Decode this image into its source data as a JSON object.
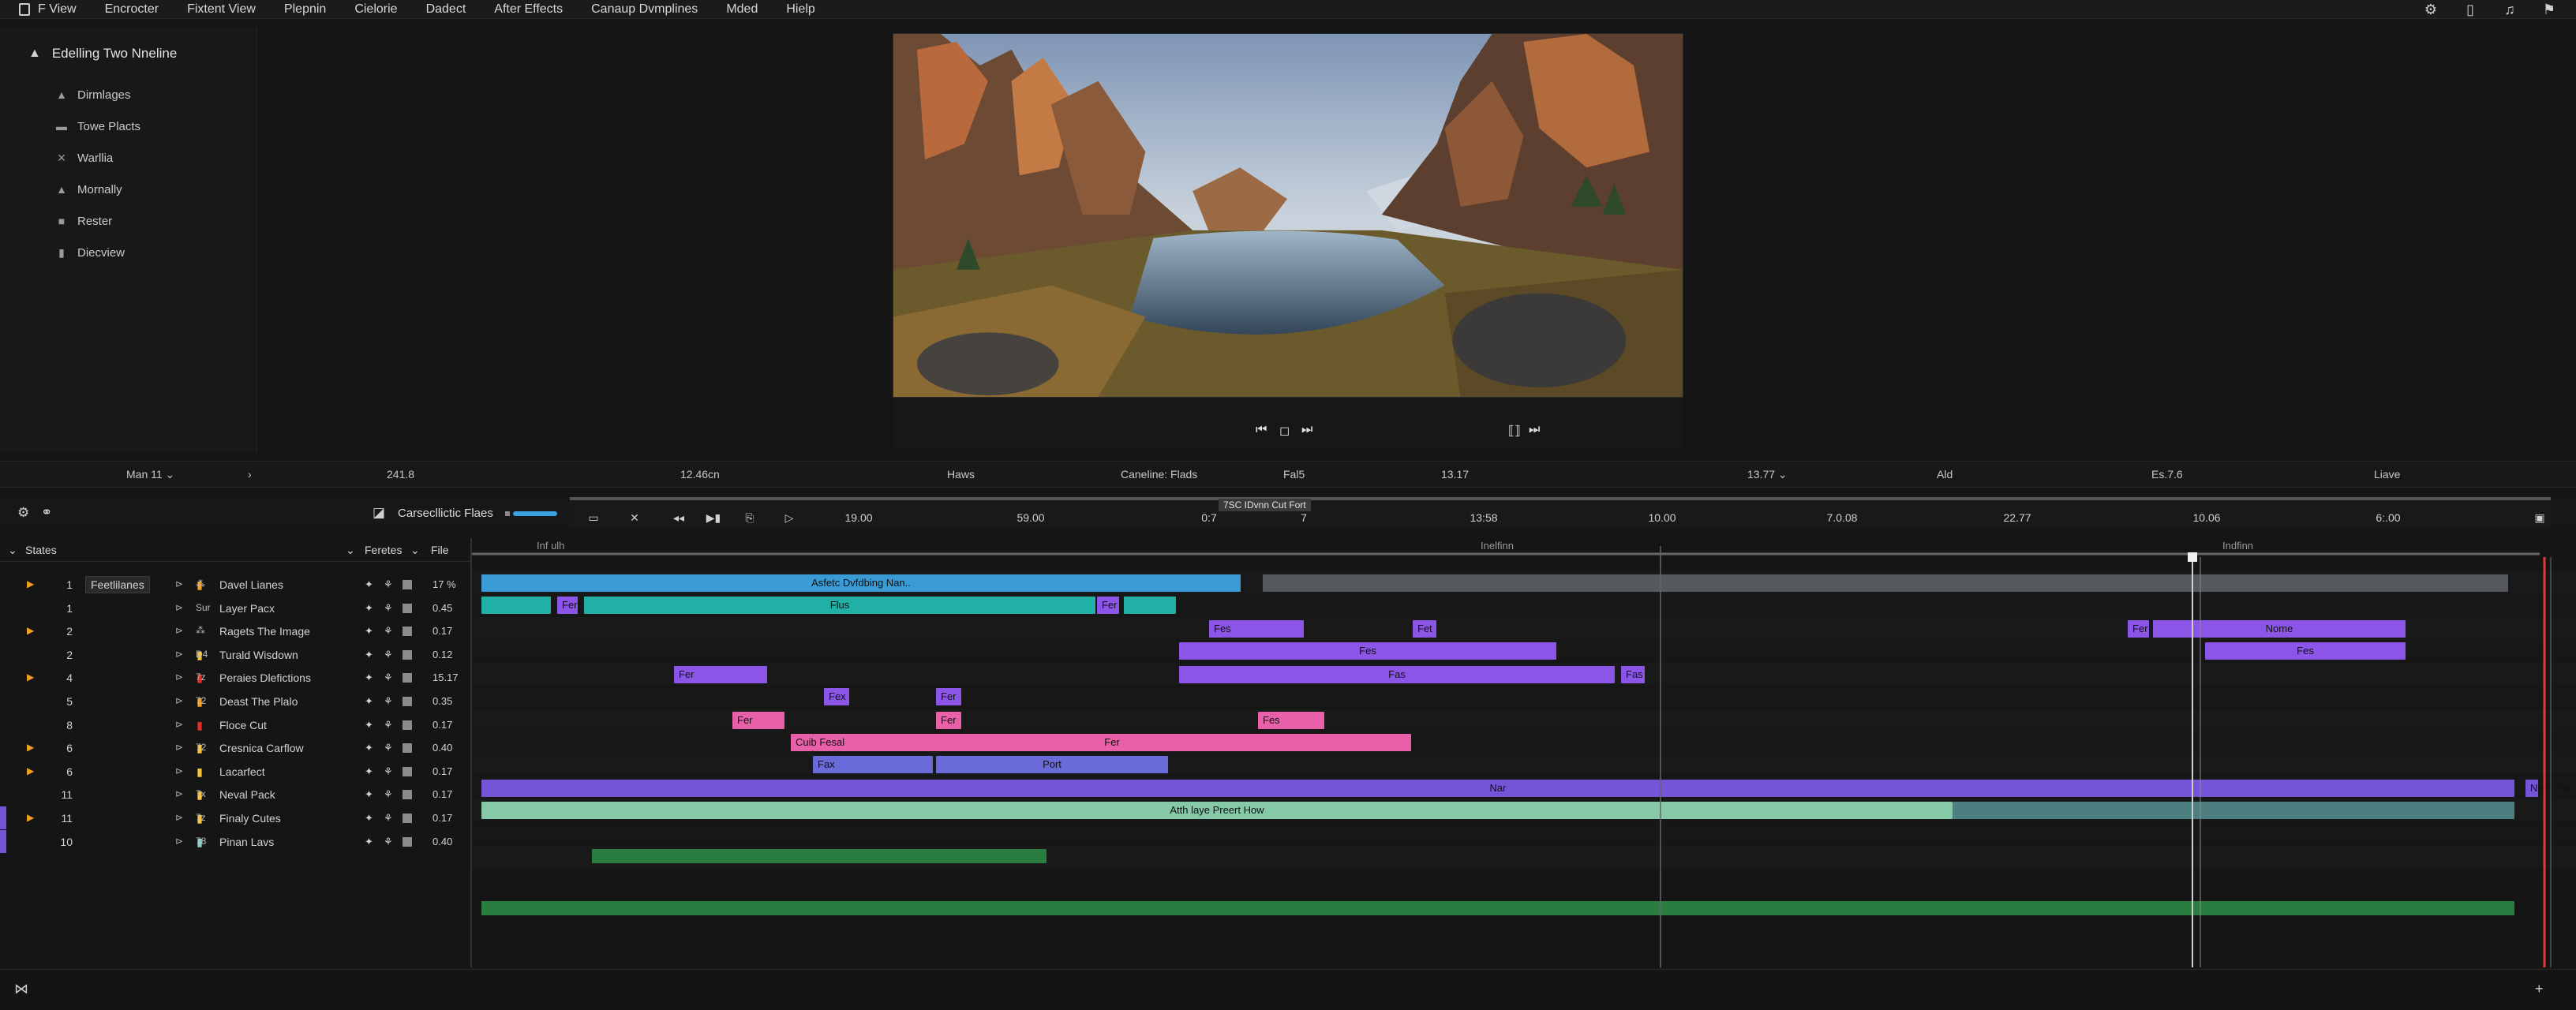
{
  "menu": {
    "items": [
      "F View",
      "Encrocter",
      "Fixtent View",
      "Plepnin",
      "Cielorie",
      "Dadect",
      "After Effects",
      "Canaup Dvmplines",
      "Mded",
      "Hielp"
    ],
    "right_icons": [
      "gear-icon",
      "bookmark-icon",
      "bell-icon",
      "flag-icon"
    ]
  },
  "project": {
    "title": "Edelling Two Nneline",
    "items": [
      {
        "label": "Dirmlages",
        "icon": "folder-icon"
      },
      {
        "label": "Towe Placts",
        "icon": "folder-icon"
      },
      {
        "label": "Warllia",
        "icon": "tools-icon"
      },
      {
        "label": "Mornally",
        "icon": "folder-icon"
      },
      {
        "label": "Rester",
        "icon": "folder-icon"
      },
      {
        "label": "Diecview",
        "icon": "folder-icon"
      }
    ]
  },
  "viewer": {
    "controls": [
      "skip-back-icon",
      "stop-icon",
      "skip-forward-icon",
      "frame-icon",
      "next-frame-icon"
    ]
  },
  "info_strip": {
    "items": [
      "Man 11 ⌄",
      "›",
      "241.8",
      "12.46cn",
      "Haws",
      "Caneline: Flads",
      "Fal5",
      "13.17",
      "13.77 ⌄",
      "Ald",
      "Es.7.6",
      "Liave"
    ]
  },
  "timeline_toolbar": {
    "comp_label": "Carsecllictic Flaes"
  },
  "ruler": {
    "hint": "7SC IDvnn Cut Fort",
    "ticks": [
      "19.00",
      "59.00",
      "0:7",
      "7",
      "13:58",
      "10.00",
      "7.0.08",
      "22.77",
      "10.06",
      "6:.00"
    ],
    "sub_labels": [
      "Inf ulh",
      "Inelfinn",
      "Indfinn"
    ]
  },
  "layer_header": {
    "states_label": "States",
    "effects_label": "Feretes",
    "file_label": "File"
  },
  "layers": [
    {
      "num": "1",
      "name": "Davel Lianes",
      "val": "17 %",
      "tri": "▶",
      "type": "⁂",
      "label_color": "#f0a020",
      "tag": "Feetlilanes"
    },
    {
      "num": "1",
      "name": "Layer Pacx",
      "val": "0.45",
      "tri": "",
      "type": "Sur",
      "label_color": ""
    },
    {
      "num": "2",
      "name": "Ragets The Image",
      "val": "0.17",
      "tri": "▶",
      "type": "⁂",
      "label_color": ""
    },
    {
      "num": "2",
      "name": "Turald Wisdown",
      "val": "0.12",
      "tri": "",
      "type": "D4",
      "label_color": "#f5c242"
    },
    {
      "num": "4",
      "name": "Peraies Dlefictions",
      "val": "15.17",
      "tri": "▶",
      "type": "7z",
      "label_color": "#e0302a"
    },
    {
      "num": "5",
      "name": "Deast The Plalo",
      "val": "0.35",
      "tri": "",
      "type": "72",
      "label_color": "#f0a020"
    },
    {
      "num": "8",
      "name": "Floce Cut",
      "val": "0.17",
      "tri": "",
      "type": "",
      "label_color": "#e0302a"
    },
    {
      "num": "6",
      "name": "Cresnica Carflow",
      "val": "0.40",
      "tri": "▶",
      "type": "72",
      "label_color": "#f5c242"
    },
    {
      "num": "6",
      "name": "Lacarfect",
      "val": "0.17",
      "tri": "▶",
      "type": "",
      "label_color": "#f5c242"
    },
    {
      "num": "11",
      "name": "Neval Pack",
      "val": "0.17",
      "tri": "",
      "type": "7x",
      "label_color": "#f5c242"
    },
    {
      "num": "11",
      "name": "Finaly Cutes",
      "val": "0.17",
      "tri": "▶",
      "type": "7z",
      "label_color": "#f5c242"
    },
    {
      "num": "10",
      "name": "Pinan Lavs",
      "val": "0.40",
      "tri": "",
      "type": "78",
      "label_color": "#8fd0c8"
    }
  ],
  "clips": [
    {
      "row": 0,
      "text": "Asfetc Dvfdbing Nan..",
      "color": "#3a9bd5"
    },
    {
      "row": 0,
      "text": "",
      "color": "#55585d"
    },
    {
      "row": 1,
      "text": "",
      "color": "#21b0a6"
    },
    {
      "row": 1,
      "text": "Fer",
      "color": "#8b55e8"
    },
    {
      "row": 1,
      "text": "Flus",
      "color": "#21b0a6"
    },
    {
      "row": 1,
      "text": "Fer",
      "color": "#8b55e8"
    },
    {
      "row": 1,
      "text": "",
      "color": "#21b0a6"
    },
    {
      "row": 2,
      "text": "Fes",
      "color": "#8b55e8"
    },
    {
      "row": 2,
      "text": "Fet",
      "color": "#8b55e8"
    },
    {
      "row": 2,
      "text": "Fer",
      "color": "#8b55e8"
    },
    {
      "row": 2,
      "text": "Nome",
      "color": "#8b55e8"
    },
    {
      "row": 3,
      "text": "Fes",
      "color": "#8b55e8"
    },
    {
      "row": 3,
      "text": "Fes",
      "color": "#8b55e8"
    },
    {
      "row": 4,
      "text": "Fer",
      "color": "#8b55e8"
    },
    {
      "row": 4,
      "text": "Fas",
      "color": "#8b55e8"
    },
    {
      "row": 4,
      "text": "Fas",
      "color": "#8b55e8"
    },
    {
      "row": 5,
      "text": "Fex",
      "color": "#8b55e8"
    },
    {
      "row": 5,
      "text": "Fer",
      "color": "#8b55e8"
    },
    {
      "row": 6,
      "text": "Fer",
      "color": "#e760a8"
    },
    {
      "row": 6,
      "text": "Fer",
      "color": "#e760a8"
    },
    {
      "row": 6,
      "text": "Fes",
      "color": "#e760a8"
    },
    {
      "row": 7,
      "text": "Fer",
      "color": "#e760a8"
    },
    {
      "row": 7,
      "text": "Cuib Fesal",
      "color": "#e760a8"
    },
    {
      "row": 8,
      "text": "Fax",
      "color": "#6a6ad8"
    },
    {
      "row": 8,
      "text": "Port",
      "color": "#6a6ad8"
    },
    {
      "row": 9,
      "text": "Nar",
      "color": "#7455d8"
    },
    {
      "row": 9,
      "text": "Ne & Fer",
      "color": "#7455d8"
    },
    {
      "row": 10,
      "text": "Atth laye Preert How",
      "color": "#86c9a8"
    },
    {
      "row": 10,
      "text": "",
      "color": "#4d7f80"
    },
    {
      "row": 11,
      "text": "",
      "color": "#2a7d40"
    },
    {
      "row": 12,
      "text": "",
      "color": "#2a7d40"
    }
  ]
}
